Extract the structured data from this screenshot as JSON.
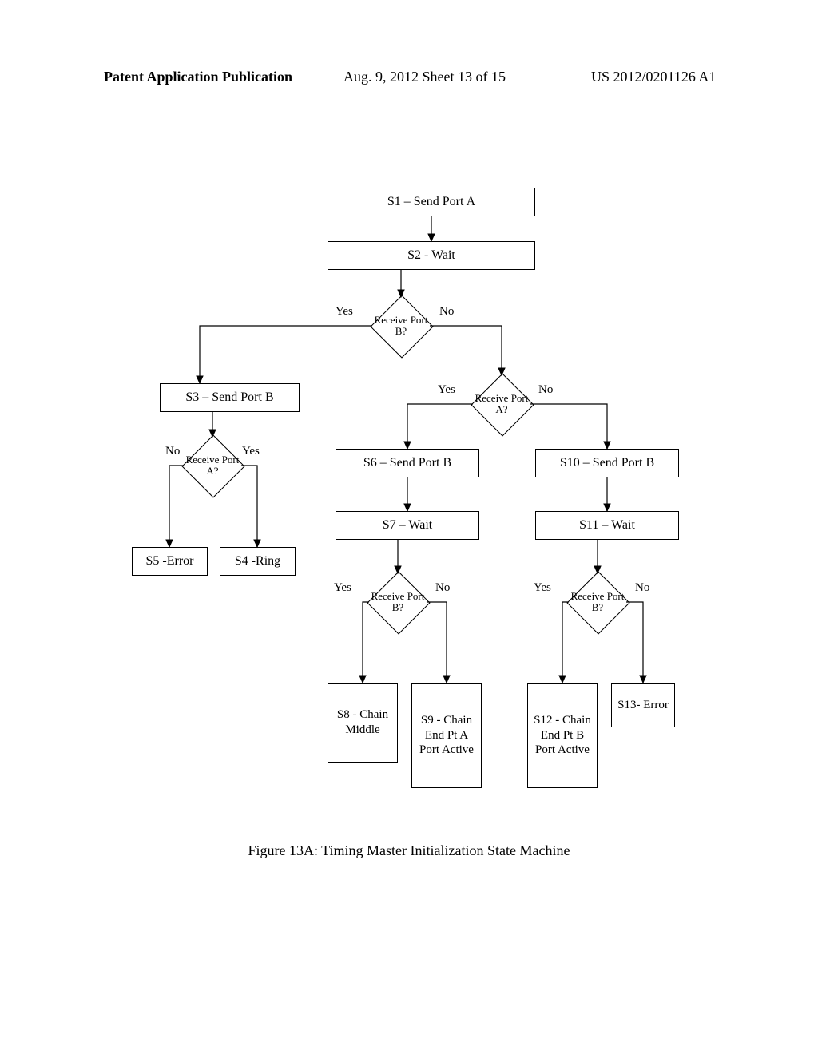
{
  "header": {
    "left": "Patent Application Publication",
    "mid": "Aug. 9, 2012  Sheet 13 of 15",
    "right": "US 2012/0201126 A1"
  },
  "caption": "Figure 13A:  Timing Master Initialization State Machine",
  "labels": {
    "yes": "Yes",
    "no": "No"
  },
  "nodes": {
    "s1": "S1 – Send Port A",
    "s2": "S2 - Wait",
    "d1": "Receive Port B?",
    "s3": "S3 – Send Port B",
    "d2": "Receive Port A?",
    "s6": "S6 – Send Port B",
    "s7": "S7 – Wait",
    "s10": "S10 – Send Port B",
    "s11": "S11 – Wait",
    "d3": "Receive Port A?",
    "s5": "S5 -Error",
    "s4": "S4 -Ring",
    "d4": "Receive Port B?",
    "d5": "Receive Port B?",
    "s8": "S8 - Chain Middle",
    "s9": "S9 - Chain End Pt A Port Active",
    "s12": "S12 - Chain End Pt B Port Active",
    "s13": "S13- Error"
  },
  "chart_data": {
    "type": "flowchart",
    "title": "Figure 13A: Timing Master Initialization State Machine",
    "nodes": [
      {
        "id": "S1",
        "kind": "process",
        "label": "S1 – Send Port A"
      },
      {
        "id": "S2",
        "kind": "process",
        "label": "S2 - Wait"
      },
      {
        "id": "D1",
        "kind": "decision",
        "label": "Receive Port B?"
      },
      {
        "id": "S3",
        "kind": "process",
        "label": "S3 – Send Port B"
      },
      {
        "id": "D2",
        "kind": "decision",
        "label": "Receive Port A?"
      },
      {
        "id": "S6",
        "kind": "process",
        "label": "S6 – Send Port B"
      },
      {
        "id": "S7",
        "kind": "process",
        "label": "S7 – Wait"
      },
      {
        "id": "S10",
        "kind": "process",
        "label": "S10 – Send Port B"
      },
      {
        "id": "S11",
        "kind": "process",
        "label": "S11 – Wait"
      },
      {
        "id": "D3",
        "kind": "decision",
        "label": "Receive Port A?"
      },
      {
        "id": "S5",
        "kind": "terminal",
        "label": "S5 - Error"
      },
      {
        "id": "S4",
        "kind": "terminal",
        "label": "S4 - Ring"
      },
      {
        "id": "D4",
        "kind": "decision",
        "label": "Receive Port B?"
      },
      {
        "id": "D5",
        "kind": "decision",
        "label": "Receive Port B?"
      },
      {
        "id": "S8",
        "kind": "terminal",
        "label": "S8 - Chain Middle"
      },
      {
        "id": "S9",
        "kind": "terminal",
        "label": "S9 - Chain End Pt A Port Active"
      },
      {
        "id": "S12",
        "kind": "terminal",
        "label": "S12 - Chain End Pt B Port Active"
      },
      {
        "id": "S13",
        "kind": "terminal",
        "label": "S13 - Error"
      }
    ],
    "edges": [
      {
        "from": "S1",
        "to": "S2"
      },
      {
        "from": "S2",
        "to": "D1"
      },
      {
        "from": "D1",
        "to": "S3",
        "label": "Yes"
      },
      {
        "from": "D1",
        "to": "D2",
        "label": "No"
      },
      {
        "from": "S3",
        "to": "D3"
      },
      {
        "from": "D3",
        "to": "S5",
        "label": "No"
      },
      {
        "from": "D3",
        "to": "S4",
        "label": "Yes"
      },
      {
        "from": "D2",
        "to": "S6",
        "label": "Yes"
      },
      {
        "from": "D2",
        "to": "S10",
        "label": "No"
      },
      {
        "from": "S6",
        "to": "S7"
      },
      {
        "from": "S7",
        "to": "D4"
      },
      {
        "from": "D4",
        "to": "S8",
        "label": "Yes"
      },
      {
        "from": "D4",
        "to": "S9",
        "label": "No"
      },
      {
        "from": "S10",
        "to": "S11"
      },
      {
        "from": "S11",
        "to": "D5"
      },
      {
        "from": "D5",
        "to": "S12",
        "label": "Yes"
      },
      {
        "from": "D5",
        "to": "S13",
        "label": "No"
      }
    ]
  }
}
